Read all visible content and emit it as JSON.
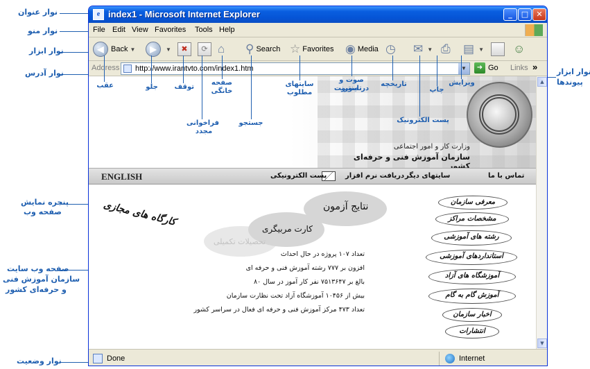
{
  "annotations": {
    "title_bar": "نوار عنوان",
    "menu_bar": "نوار منو",
    "toolbar": "نوار ابزار",
    "address_bar": "نوار آدرس",
    "links_bar_line1": "نوار ابزار",
    "links_bar_line2": "پیوندها",
    "web_page_window_line1": "پنجره نمایش",
    "web_page_window_line2": "صفحه وب",
    "website_line1": "صفحه وب سایت",
    "website_line2": "سازمان آموزش فنی",
    "website_line3": "و حرفه‌ای کشور",
    "status_bar": "نوار وضعیت",
    "back": "عقب",
    "forward": "جلو",
    "stop": "توقف",
    "refresh_line1": "فراخوانی",
    "refresh_line2": "مجدد",
    "home_line1": "صفحه",
    "home_line2": "خانگی",
    "search": "جستجو",
    "favorites_line1": "سایتهای",
    "favorites_line2": "مطلوب",
    "media_line1": "صوت و تصویر",
    "media_line2": "در اینترنت",
    "history": "تاریخچه",
    "mail": "پست الکترونیک",
    "print": "چاپ",
    "edit": "ویرایش"
  },
  "window": {
    "title": "index1 - Microsoft Internet Explorer",
    "title_icon": "e",
    "minimize_glyph": "_",
    "maximize_glyph": "□",
    "close_glyph": "✕"
  },
  "menu": {
    "items": [
      "File",
      "Edit",
      "View",
      "Favorites",
      "Tools",
      "Help"
    ]
  },
  "toolbar": {
    "back_label": "Back",
    "search_label": "Search",
    "favorites_label": "Favorites",
    "media_label": "Media"
  },
  "address": {
    "label": "Address",
    "value": "http://www.irantvto.com/index1.htm",
    "go_label": "Go",
    "links_label": "Links",
    "links_chevron": "»"
  },
  "status": {
    "text": "Done",
    "zone": "Internet"
  },
  "site": {
    "org_sub": "وزارت کار و امور اجتماعی",
    "org_name": "سازمان آموزش فنی و حرفه‌ای کشور",
    "nav": {
      "english": "ENGLISH",
      "mail": "پست الکترونیکی",
      "download": "دریافت نرم افزار",
      "other_sites": "سایتهای دیگر",
      "contact": "تماس با ما"
    },
    "menu_ovals": [
      "معرفی سازمان",
      "مشخصات مراکز",
      "رشته های آموزشی",
      "استانداردهای آموزشی",
      "آموزشگاه های آزاد",
      "آموزش گام به گام",
      "اخبار سازمان",
      "انتشارات"
    ],
    "clouds": {
      "exam": "نتایج آزمون",
      "card": "کارت مربیگری",
      "faint": "تحصیلات تکمیلی"
    },
    "slogan": "کارگاه های مجازی",
    "news": [
      "تعداد ۱۰۷ پروژه در حال احداث",
      "افزون بر ۷۷۷ رشته آموزش فنی و حرفه ای",
      "بالغ بر ۷۵۱۳۶۴۷ نفر کار آموز در سال ۸۰",
      "بیش از ۱۰۴۵۶ آموزشگاه آزاد تحت نظارت سازمان",
      "تعداد ۴۷۳ مرکز آموزش فنی و حرفه ای فعال در سراسر کشور"
    ]
  },
  "colors": {
    "annotation": "#1f5fb0",
    "titlebar": "#0554d6"
  }
}
